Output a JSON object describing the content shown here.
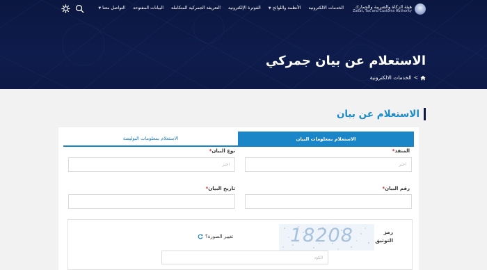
{
  "header": {
    "logo": {
      "name_ar": "هيئة الزكاة والضريبة والجمارك",
      "name_en": "Zakat, Tax and Customs Authority"
    },
    "nav": [
      {
        "label": "الخدمات الالكترونية",
        "has_caret": false
      },
      {
        "label": "الأنظمة واللوائح",
        "has_caret": true
      },
      {
        "label": "الفوترة الإلكترونية",
        "has_caret": false
      },
      {
        "label": "التعريفة الجمركية المتكاملة",
        "has_caret": false
      },
      {
        "label": "البيانات المفتوحة",
        "has_caret": false
      },
      {
        "label": "التواصل معنا",
        "has_caret": true
      }
    ],
    "icons": {
      "search": "search-icon",
      "accessibility": "gear-icon"
    }
  },
  "hero": {
    "title": "الاستعلام عن بيان جمركي",
    "breadcrumb": {
      "home_icon": "home-icon",
      "separator": ">",
      "item": "الخدمات الالكترونية"
    }
  },
  "section": {
    "heading": "الاستعلام عن بيان"
  },
  "tabs": [
    {
      "label": "الاستعلام بمعلومات البيان",
      "active": true
    },
    {
      "label": "الاستعلام بمعلومات البوليصة",
      "active": false
    }
  ],
  "form": {
    "port": {
      "label": "المنفذ",
      "required": "*",
      "placeholder": "اختر"
    },
    "declaration_type": {
      "label": "نوع البيان",
      "required": "*",
      "placeholder": "اختر"
    },
    "declaration_number": {
      "label": "رقم البيان",
      "required": "*",
      "value": ""
    },
    "declaration_date": {
      "label": "تاريخ البيان",
      "required": "*",
      "value": ""
    }
  },
  "captcha": {
    "label_line1": "رمز",
    "label_line2": "التوثيق :",
    "image_text": "18208",
    "refresh_label": "تغيير الصورة؟",
    "input_placeholder": "الكود"
  },
  "colors": {
    "header_bg": "#0d1a47",
    "accent_blue": "#1a86c8",
    "heading_blue": "#1d8bc9",
    "required_red": "#d02525",
    "page_bg": "#f2f2f2"
  }
}
